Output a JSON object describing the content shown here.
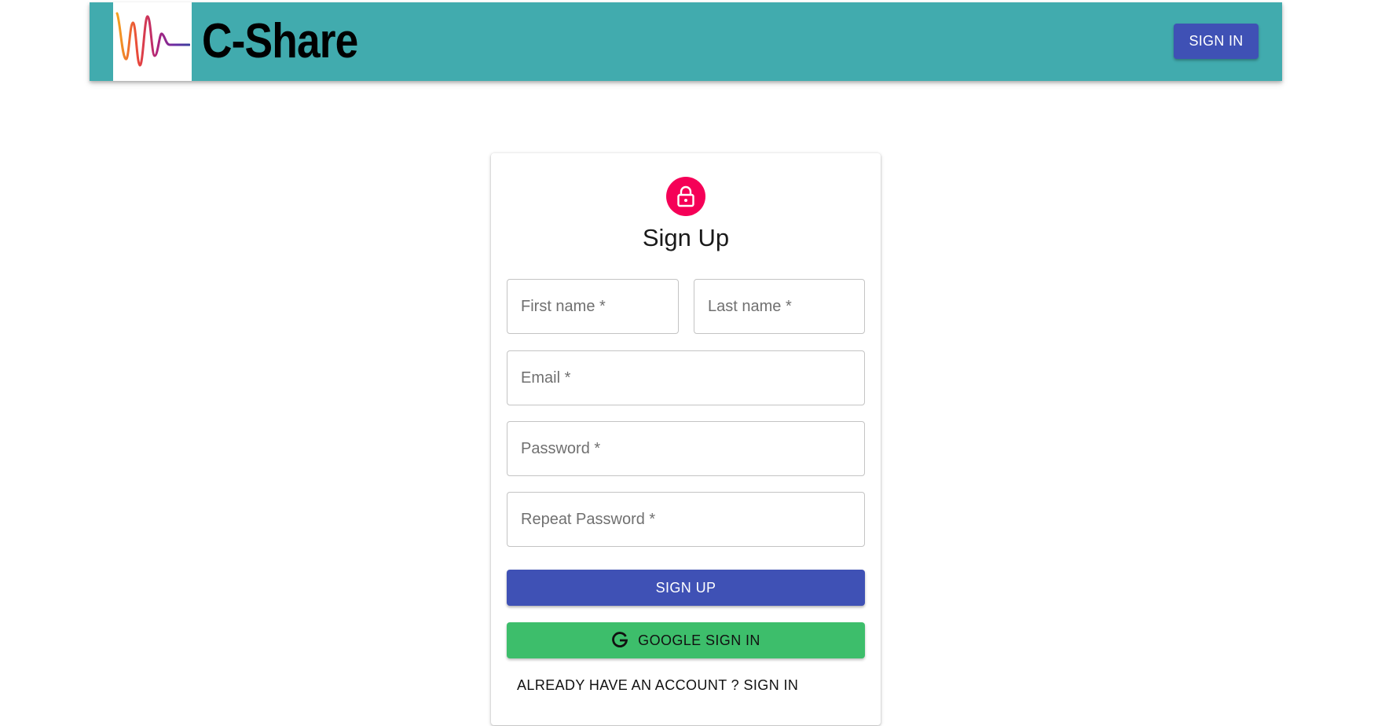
{
  "header": {
    "brand": "C-Share",
    "signin_label": "SIGN IN",
    "background": "#41abae",
    "logo_icon": "waveform-logo-icon"
  },
  "signup": {
    "icon": "lock-icon",
    "title": "Sign Up",
    "fields": {
      "first_name": {
        "value": "",
        "placeholder": "First name *"
      },
      "last_name": {
        "value": "",
        "placeholder": "Last name *"
      },
      "email": {
        "value": "",
        "placeholder": "Email *"
      },
      "password": {
        "value": "",
        "placeholder": "Password *"
      },
      "repeat_password": {
        "value": "",
        "placeholder": "Repeat Password *"
      }
    },
    "signup_label": "SIGN UP",
    "google_label": "GOOGLE SIGN IN",
    "google_icon": "google-g-icon",
    "account_link": "ALREADY HAVE AN ACCOUNT ? SIGN IN"
  },
  "colors": {
    "primary": "#3f51b5",
    "google": "#3dbe6b",
    "avatar": "#f50057"
  }
}
